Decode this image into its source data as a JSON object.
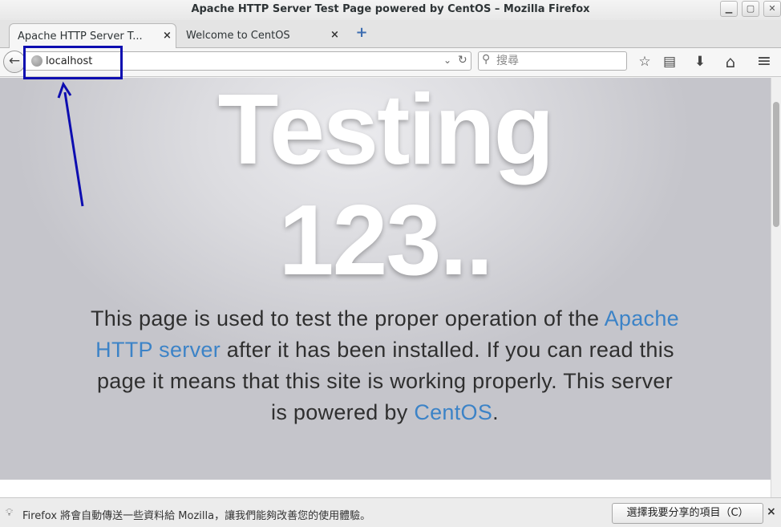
{
  "window": {
    "title": "Apache HTTP Server Test Page powered by CentOS – Mozilla Firefox",
    "controls": {
      "minimize": "▁",
      "maximize": "▢",
      "close": "✕"
    }
  },
  "tabs": [
    {
      "label": "Apache HTTP Server T...",
      "active": true,
      "close": "×"
    },
    {
      "label": "Welcome to CentOS",
      "active": false,
      "close": "×"
    }
  ],
  "new_tab_label": "+",
  "navbar": {
    "back_glyph": "←",
    "url": "localhost",
    "url_dropdown_glyph": "⌄",
    "reload_glyph": "↻",
    "search_placeholder": "搜尋",
    "search_glyph": "⚲",
    "icons": {
      "bookmark": "☆",
      "reading_list": "▤",
      "download": "⬇",
      "home": "⌂",
      "menu": "≡"
    }
  },
  "page": {
    "hero_line1": "Testing",
    "hero_line2": "123..",
    "lead_part1": "This page is used to test the proper operation of the ",
    "lead_link1": "Apache HTTP server",
    "lead_part2": " after it has been installed. If you can read this page it means that this site is working properly. This server is powered by ",
    "lead_link2": "CentOS",
    "lead_part3": "."
  },
  "notification": {
    "text": "Firefox 將會自動傳送一些資料給  Mozilla，讓我們能夠改善您的使用體驗。",
    "button_label": "選擇我要分享的項目（C）",
    "close_glyph": "×"
  },
  "colors": {
    "annotation": "#0d0db0",
    "link": "#3c83c7",
    "hero_text": "#ffffff"
  }
}
